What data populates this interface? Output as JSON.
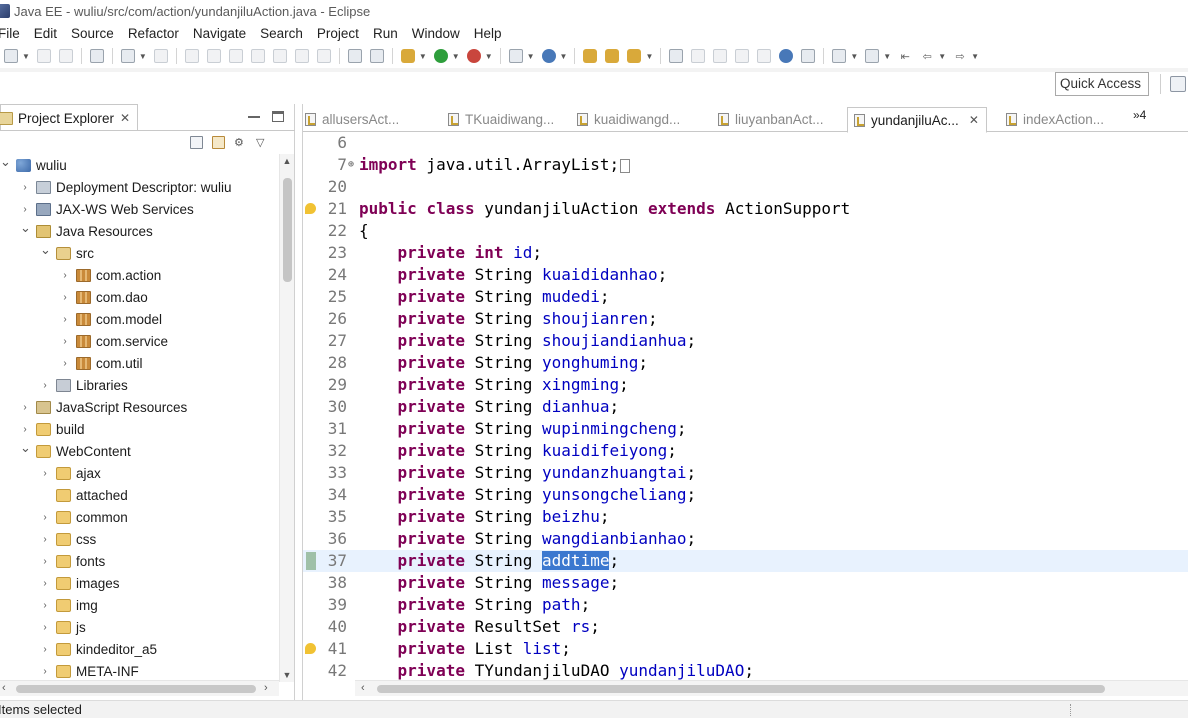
{
  "window": {
    "title": "Java EE - wuliu/src/com/action/yundanjiluAction.java - Eclipse"
  },
  "menubar": [
    "File",
    "Edit",
    "Source",
    "Refactor",
    "Navigate",
    "Search",
    "Project",
    "Run",
    "Window",
    "Help"
  ],
  "quick_access": {
    "label": "Quick Access"
  },
  "explorer": {
    "title": "Project Explorer",
    "tree": [
      {
        "label": "wuliu",
        "depth": 0,
        "expanded": true,
        "icon": "project-icon"
      },
      {
        "label": "Deployment Descriptor: wuliu",
        "depth": 1,
        "expanded": false,
        "icon": "deployment-descriptor-icon"
      },
      {
        "label": "JAX-WS Web Services",
        "depth": 1,
        "expanded": false,
        "icon": "web-services-icon"
      },
      {
        "label": "Java Resources",
        "depth": 1,
        "expanded": true,
        "icon": "java-resources-icon"
      },
      {
        "label": "src",
        "depth": 2,
        "expanded": true,
        "icon": "source-folder-icon"
      },
      {
        "label": "com.action",
        "depth": 3,
        "expanded": false,
        "icon": "package-icon"
      },
      {
        "label": "com.dao",
        "depth": 3,
        "expanded": false,
        "icon": "package-icon"
      },
      {
        "label": "com.model",
        "depth": 3,
        "expanded": false,
        "icon": "package-icon"
      },
      {
        "label": "com.service",
        "depth": 3,
        "expanded": false,
        "icon": "package-icon"
      },
      {
        "label": "com.util",
        "depth": 3,
        "expanded": false,
        "icon": "package-icon"
      },
      {
        "label": "Libraries",
        "depth": 2,
        "expanded": false,
        "icon": "libraries-icon"
      },
      {
        "label": "JavaScript Resources",
        "depth": 1,
        "expanded": false,
        "icon": "javascript-resources-icon"
      },
      {
        "label": "build",
        "depth": 1,
        "expanded": false,
        "icon": "folder-icon"
      },
      {
        "label": "WebContent",
        "depth": 1,
        "expanded": true,
        "icon": "folder-icon"
      },
      {
        "label": "ajax",
        "depth": 2,
        "expanded": false,
        "icon": "folder-icon"
      },
      {
        "label": "attached",
        "depth": 2,
        "leaf": true,
        "icon": "folder-icon"
      },
      {
        "label": "common",
        "depth": 2,
        "expanded": false,
        "icon": "folder-icon"
      },
      {
        "label": "css",
        "depth": 2,
        "expanded": false,
        "icon": "folder-icon"
      },
      {
        "label": "fonts",
        "depth": 2,
        "expanded": false,
        "icon": "folder-icon"
      },
      {
        "label": "images",
        "depth": 2,
        "expanded": false,
        "icon": "folder-icon"
      },
      {
        "label": "img",
        "depth": 2,
        "expanded": false,
        "icon": "folder-icon"
      },
      {
        "label": "js",
        "depth": 2,
        "expanded": false,
        "icon": "folder-icon"
      },
      {
        "label": "kindeditor_a5",
        "depth": 2,
        "expanded": false,
        "icon": "folder-icon"
      },
      {
        "label": "META-INF",
        "depth": 2,
        "expanded": false,
        "icon": "folder-icon"
      }
    ]
  },
  "editor": {
    "tabs": [
      {
        "label": "allusersAct...",
        "active": false
      },
      {
        "label": "TKuaidiwang...",
        "active": false
      },
      {
        "label": "kuaidiwangd...",
        "active": false
      },
      {
        "label": "liuyanbanAct...",
        "active": false
      },
      {
        "label": "yundanjiluAc...",
        "active": true
      },
      {
        "label": "indexAction...",
        "active": false
      }
    ],
    "overflow_label": "»4",
    "highlight_color": "#e8f2fe",
    "keyword_color": "#7f0055",
    "field_color": "#0000c0",
    "lines": [
      {
        "n": "6",
        "tokens": []
      },
      {
        "n": "7",
        "fold": "⊕",
        "tokens": [
          {
            "t": "import",
            "c": "kw"
          },
          {
            "t": " java.util.ArrayList;"
          }
        ],
        "collapsed": true
      },
      {
        "n": "20",
        "tokens": []
      },
      {
        "n": "21",
        "marker": "warn",
        "tokens": [
          {
            "t": "public",
            "c": "kw"
          },
          {
            "t": " "
          },
          {
            "t": "class",
            "c": "kw"
          },
          {
            "t": " yundanjiluAction "
          },
          {
            "t": "extends",
            "c": "kw"
          },
          {
            "t": " ActionSupport"
          }
        ]
      },
      {
        "n": "22",
        "tokens": [
          {
            "t": "{"
          }
        ]
      },
      {
        "n": "23",
        "tokens": [
          {
            "t": "    "
          },
          {
            "t": "private",
            "c": "kw"
          },
          {
            "t": " "
          },
          {
            "t": "int",
            "c": "kw"
          },
          {
            "t": " "
          },
          {
            "t": "id",
            "c": "fld"
          },
          {
            "t": ";"
          }
        ]
      },
      {
        "n": "24",
        "tokens": [
          {
            "t": "    "
          },
          {
            "t": "private",
            "c": "kw"
          },
          {
            "t": " String "
          },
          {
            "t": "kuaididanhao",
            "c": "fld"
          },
          {
            "t": ";"
          }
        ]
      },
      {
        "n": "25",
        "tokens": [
          {
            "t": "    "
          },
          {
            "t": "private",
            "c": "kw"
          },
          {
            "t": " String "
          },
          {
            "t": "mudedi",
            "c": "fld"
          },
          {
            "t": ";"
          }
        ]
      },
      {
        "n": "26",
        "tokens": [
          {
            "t": "    "
          },
          {
            "t": "private",
            "c": "kw"
          },
          {
            "t": " String "
          },
          {
            "t": "shoujianren",
            "c": "fld"
          },
          {
            "t": ";"
          }
        ]
      },
      {
        "n": "27",
        "tokens": [
          {
            "t": "    "
          },
          {
            "t": "private",
            "c": "kw"
          },
          {
            "t": " String "
          },
          {
            "t": "shoujiandianhua",
            "c": "fld"
          },
          {
            "t": ";"
          }
        ]
      },
      {
        "n": "28",
        "tokens": [
          {
            "t": "    "
          },
          {
            "t": "private",
            "c": "kw"
          },
          {
            "t": " String "
          },
          {
            "t": "yonghuming",
            "c": "fld"
          },
          {
            "t": ";"
          }
        ]
      },
      {
        "n": "29",
        "tokens": [
          {
            "t": "    "
          },
          {
            "t": "private",
            "c": "kw"
          },
          {
            "t": " String "
          },
          {
            "t": "xingming",
            "c": "fld"
          },
          {
            "t": ";"
          }
        ]
      },
      {
        "n": "30",
        "tokens": [
          {
            "t": "    "
          },
          {
            "t": "private",
            "c": "kw"
          },
          {
            "t": " String "
          },
          {
            "t": "dianhua",
            "c": "fld"
          },
          {
            "t": ";"
          }
        ]
      },
      {
        "n": "31",
        "tokens": [
          {
            "t": "    "
          },
          {
            "t": "private",
            "c": "kw"
          },
          {
            "t": " String "
          },
          {
            "t": "wupinmingcheng",
            "c": "fld"
          },
          {
            "t": ";"
          }
        ]
      },
      {
        "n": "32",
        "tokens": [
          {
            "t": "    "
          },
          {
            "t": "private",
            "c": "kw"
          },
          {
            "t": " String "
          },
          {
            "t": "kuaidifeiyong",
            "c": "fld"
          },
          {
            "t": ";"
          }
        ]
      },
      {
        "n": "33",
        "tokens": [
          {
            "t": "    "
          },
          {
            "t": "private",
            "c": "kw"
          },
          {
            "t": " String "
          },
          {
            "t": "yundanzhuangtai",
            "c": "fld"
          },
          {
            "t": ";"
          }
        ]
      },
      {
        "n": "34",
        "tokens": [
          {
            "t": "    "
          },
          {
            "t": "private",
            "c": "kw"
          },
          {
            "t": " String "
          },
          {
            "t": "yunsongcheliang",
            "c": "fld"
          },
          {
            "t": ";"
          }
        ]
      },
      {
        "n": "35",
        "tokens": [
          {
            "t": "    "
          },
          {
            "t": "private",
            "c": "kw"
          },
          {
            "t": " String "
          },
          {
            "t": "beizhu",
            "c": "fld"
          },
          {
            "t": ";"
          }
        ]
      },
      {
        "n": "36",
        "tokens": [
          {
            "t": "    "
          },
          {
            "t": "private",
            "c": "kw"
          },
          {
            "t": " String "
          },
          {
            "t": "wangdianbianhao",
            "c": "fld"
          },
          {
            "t": ";"
          }
        ]
      },
      {
        "n": "37",
        "marker": "occurrence",
        "highlight": true,
        "tokens": [
          {
            "t": "    "
          },
          {
            "t": "private",
            "c": "kw"
          },
          {
            "t": " String "
          },
          {
            "t": "addtime",
            "c": "sel"
          },
          {
            "t": ";"
          }
        ]
      },
      {
        "n": "38",
        "tokens": [
          {
            "t": "    "
          },
          {
            "t": "private",
            "c": "kw"
          },
          {
            "t": " String "
          },
          {
            "t": "message",
            "c": "fld"
          },
          {
            "t": ";"
          }
        ]
      },
      {
        "n": "39",
        "tokens": [
          {
            "t": "    "
          },
          {
            "t": "private",
            "c": "kw"
          },
          {
            "t": " String "
          },
          {
            "t": "path",
            "c": "fld"
          },
          {
            "t": ";"
          }
        ]
      },
      {
        "n": "40",
        "tokens": [
          {
            "t": "    "
          },
          {
            "t": "private",
            "c": "kw"
          },
          {
            "t": " ResultSet "
          },
          {
            "t": "rs",
            "c": "fld"
          },
          {
            "t": ";"
          }
        ]
      },
      {
        "n": "41",
        "marker": "warn",
        "tokens": [
          {
            "t": "    "
          },
          {
            "t": "private",
            "c": "kw"
          },
          {
            "t": " List "
          },
          {
            "t": "list",
            "c": "fld"
          },
          {
            "t": ";"
          }
        ]
      },
      {
        "n": "42",
        "tokens": [
          {
            "t": "    "
          },
          {
            "t": "private",
            "c": "kw"
          },
          {
            "t": " TYundanjiluDAO "
          },
          {
            "t": "yundanjiluDAO",
            "c": "fld"
          },
          {
            "t": ";"
          }
        ]
      }
    ]
  },
  "statusbar": {
    "text": "Items selected"
  }
}
